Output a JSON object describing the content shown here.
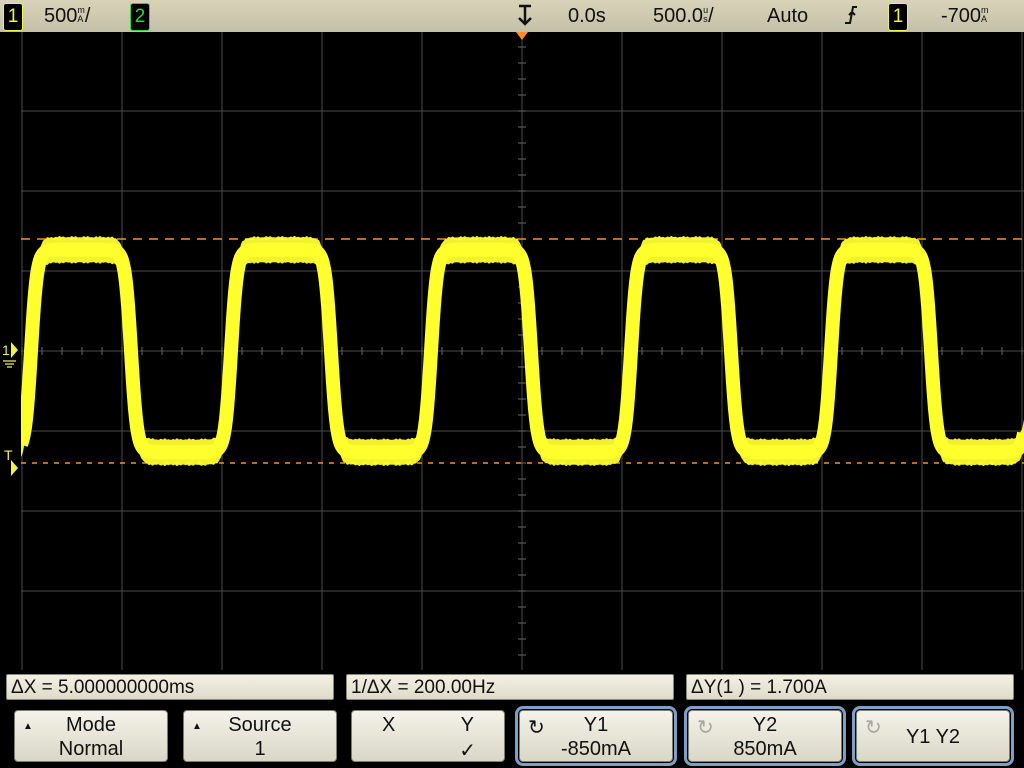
{
  "top_bar": {
    "ch1_number": "1",
    "ch1_scale": "500",
    "ch1_unit_top": "m",
    "ch1_unit_bottom": "A",
    "ch1_unit_slash": "/",
    "ch2_number": "2",
    "time_delay": "0.0s",
    "time_scale": "500.0",
    "time_unit_top": "u",
    "time_unit_bottom": "s",
    "time_unit_slash": "/",
    "trigger_mode": "Auto",
    "trigger_slope_icon": "rising-edge-icon",
    "trigger_source": "1",
    "trigger_level": "-700",
    "trigger_level_unit_top": "m",
    "trigger_level_unit_bottom": "A"
  },
  "markers": {
    "channel1": "1",
    "trigger": "T"
  },
  "waveform": {
    "color": "#ffff2e",
    "cursor_color": "#ff8c28",
    "grid_color": "#4a4a4a",
    "period_divisions": 2,
    "start_phase": 0.95,
    "high_level_divisions": 1.4,
    "low_level_divisions": -1.4,
    "trigger_level_divisions": -1.4,
    "noise_band_divisions": 0.27
  },
  "status": {
    "delta_x": "ΔX = 5.000000000ms",
    "inverse_delta_x": "1/ΔX = 200.00Hz",
    "delta_y": "ΔY(1 ) = 1.700A"
  },
  "softkeys": {
    "mode_label": "Mode",
    "mode_value": "Normal",
    "source_label": "Source",
    "source_value": "1",
    "x_label": "X",
    "y_label": "Y",
    "xy_check": "✓",
    "y1_label": "Y1",
    "y1_value": "-850mA",
    "y2_label": "Y2",
    "y2_value": "850mA",
    "y1y2_label": "Y1 Y2",
    "knob_icon": "↻"
  }
}
